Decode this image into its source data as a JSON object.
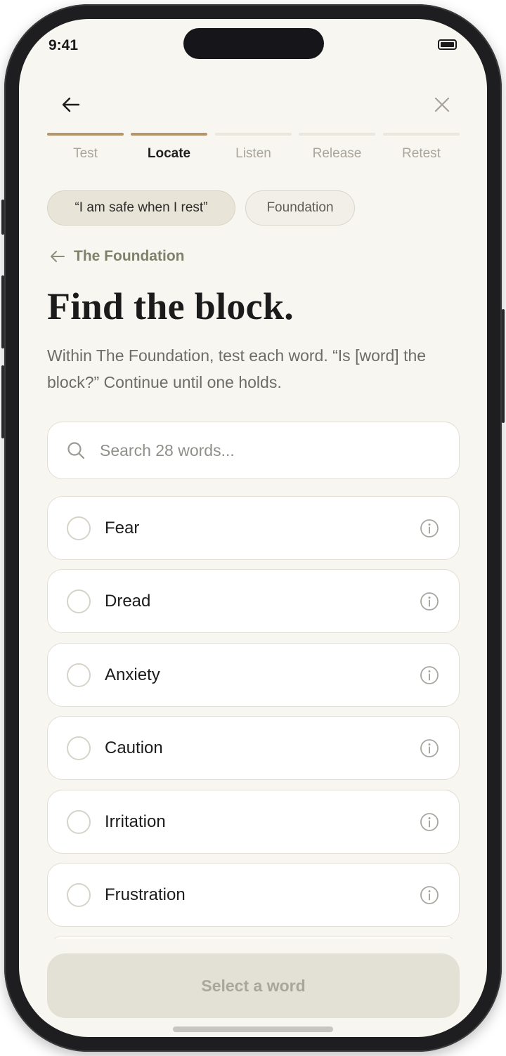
{
  "status_bar": {
    "time": "9:41"
  },
  "steps": [
    {
      "label": "Test",
      "active": true,
      "current": false
    },
    {
      "label": "Locate",
      "active": true,
      "current": true
    },
    {
      "label": "Listen",
      "active": false,
      "current": false
    },
    {
      "label": "Release",
      "active": false,
      "current": false
    },
    {
      "label": "Retest",
      "active": false,
      "current": false
    }
  ],
  "chips": {
    "affirmation": "“I am safe when I rest”",
    "tag": "Foundation"
  },
  "back_link": "The Foundation",
  "title": "Find the block.",
  "description": "Within The Foundation, test each word. “Is [word] the block?” Continue until one holds.",
  "search": {
    "placeholder": "Search 28 words...",
    "value": ""
  },
  "words": [
    "Fear",
    "Dread",
    "Anxiety",
    "Caution",
    "Irritation",
    "Frustration"
  ],
  "cta_label": "Select a word",
  "icons": {
    "back": "arrow-left-icon",
    "close": "close-icon",
    "search": "search-icon",
    "info": "info-icon",
    "radio": "radio-unselected-icon"
  },
  "colors": {
    "background": "#f8f6f0",
    "accent": "#b5946e",
    "olive": "#7f816b",
    "card": "#ffffff",
    "cta_disabled": "#e3e0d5"
  }
}
